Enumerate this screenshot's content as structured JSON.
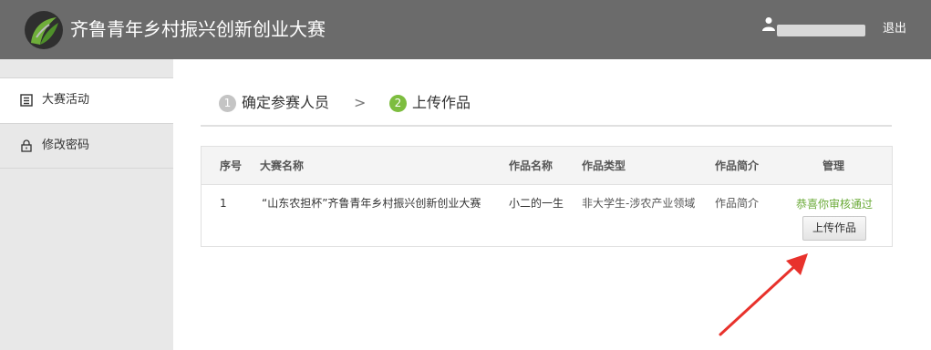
{
  "header": {
    "title": "齐鲁青年乡村振兴创新创业大赛",
    "user_name": "",
    "logout_label": "退出"
  },
  "sidebar": {
    "items": [
      {
        "label": "大赛活动",
        "icon": "contest-list-icon",
        "active": true
      },
      {
        "label": "修改密码",
        "icon": "lock-icon",
        "active": false
      }
    ]
  },
  "steps": [
    {
      "num": "1",
      "label": "确定参赛人员"
    },
    {
      "num": "2",
      "label": "上传作品"
    }
  ],
  "step_separator": ">",
  "table": {
    "headers": [
      "序号",
      "大赛名称",
      "作品名称",
      "作品类型",
      "作品简介",
      "管理"
    ],
    "rows": [
      {
        "index": "1",
        "contest": "“山东农担杯”齐鲁青年乡村振兴创新创业大赛",
        "work_name": "小二的一生",
        "work_type": "非大学生-涉农产业领域",
        "intro": "作品简介",
        "status": "恭喜你审核通过",
        "action_label": "上传作品"
      }
    ]
  },
  "colors": {
    "header_bg": "#6b6b6b",
    "accent_green": "#7dbd3f",
    "status_green": "#6aaa37",
    "annotation_arrow": "#e8322c"
  }
}
